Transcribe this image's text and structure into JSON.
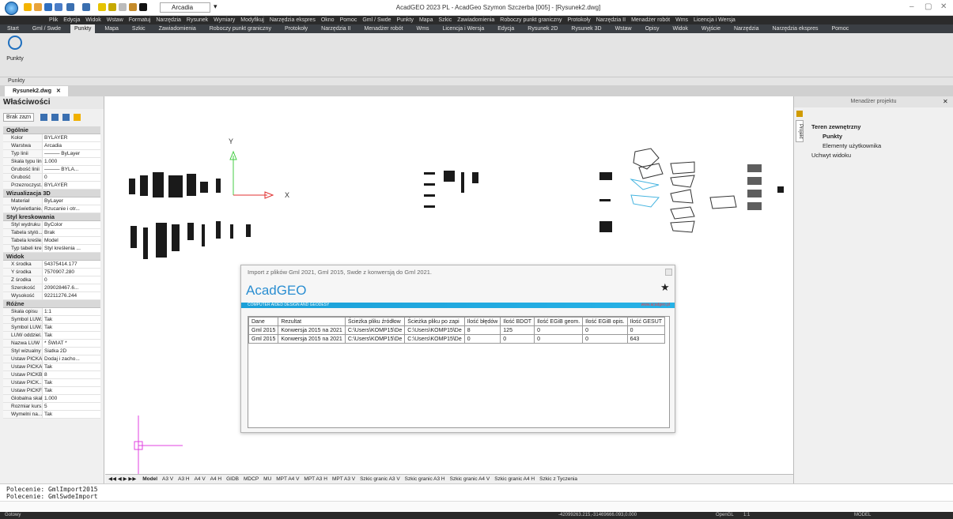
{
  "titlebar": {
    "title": "AcadGEO 2023 PL - AcadGeo Szymon Szczerba [005] - [Rysunek2.dwg]",
    "layer": "Arcadia",
    "minimize": "–",
    "maximize": "▢",
    "close": "✕"
  },
  "menu": [
    "Plik",
    "Edycja",
    "Widok",
    "Wstaw",
    "Formatuj",
    "Narzędzia",
    "Rysunek",
    "Wymiary",
    "Modyfikuj",
    "Narzędzia ekspres",
    "Okno",
    "Pomoc",
    "Gml / Swde",
    "Punkty",
    "Mapa",
    "Szkic",
    "Zawiadomienia",
    "Roboczy punkt graniczny",
    "Protokoły",
    "Narzędzia II",
    "Menadżer robót",
    "Wms",
    "Licencja i Wersja"
  ],
  "ribbon_tabs": [
    "Start",
    "Gml / Swde",
    "Punkty",
    "Mapa",
    "Szkic",
    "Zawiadomienia",
    "Roboczy punkt graniczny",
    "Protokoły",
    "Narzędzia II",
    "Menadżer robót",
    "Wms",
    "Licencja i Wersja",
    "Edycja",
    "Rysunek 2D",
    "Rysunek 3D",
    "Wstaw",
    "Opisy",
    "Widok",
    "Wyjście",
    "Narzędzia",
    "Narzędzia ekspres",
    "Pomoc"
  ],
  "ribbon": {
    "button_label": "Punkty",
    "group_label": "Punkty"
  },
  "doc_tab": {
    "label": "Rysunek2.dwg",
    "close": "✕"
  },
  "properties": {
    "title": "Właściwości",
    "selection": "Brak zazn",
    "sections": [
      {
        "name": "Ogólnie",
        "rows": [
          [
            "Kolor",
            "BYLAYER"
          ],
          [
            "Warstwa",
            "Arcadia"
          ],
          [
            "Typ linii",
            "——— ByLayer"
          ],
          [
            "Skala typu linii",
            "1.000"
          ],
          [
            "Grubość linii",
            "——— BYLA..."
          ],
          [
            "Grubość",
            "0"
          ],
          [
            "Przezroczyst...",
            "BYLAYER"
          ]
        ]
      },
      {
        "name": "Wizualizacja 3D",
        "rows": [
          [
            "Materiał",
            "ByLayer"
          ],
          [
            "Wyświetlanie...",
            "Rzucanie i otr..."
          ]
        ]
      },
      {
        "name": "Styl kreskowania",
        "rows": [
          [
            "Styl wydruku",
            "ByColor"
          ],
          [
            "Tabela styló...",
            "Brak"
          ],
          [
            "Tabela kreśle...",
            "Model"
          ],
          [
            "Typ tabeli kre...",
            "Styl kreślenia ..."
          ]
        ]
      },
      {
        "name": "Widok",
        "rows": [
          [
            "X środka",
            "54375414.177"
          ],
          [
            "Y środka",
            "7570907.280"
          ],
          [
            "Z środka",
            "0"
          ],
          [
            "Szerokość",
            "209028467.6..."
          ],
          [
            "Wysokość",
            "92211276.244"
          ]
        ]
      },
      {
        "name": "Różne",
        "rows": [
          [
            "Skala opisu",
            "1:1"
          ],
          [
            "Symbol LUW...",
            "Tak"
          ],
          [
            "Symbol LUW...",
            "Tak"
          ],
          [
            "LUW oddziel...",
            "Tak"
          ],
          [
            "Nazwa LUW",
            "* ŚWIAT *"
          ],
          [
            "Styl wizualny",
            "Siatka 2D"
          ],
          [
            "Ustaw PICKA...",
            "Dodaj i zacho..."
          ],
          [
            "Ustaw PICKA...",
            "Tak"
          ],
          [
            "Ustaw PICKB...",
            "8"
          ],
          [
            "Ustaw PICK...",
            "Tak"
          ],
          [
            "Ustaw PICKF...",
            "Tak"
          ],
          [
            "Globalna skal...",
            "1.000"
          ],
          [
            "Rozmiar kurs...",
            "5"
          ],
          [
            "Wymelni na...",
            "Tak"
          ]
        ]
      }
    ]
  },
  "ucs": {
    "x": "X",
    "y": "Y"
  },
  "layout_tabs": [
    "Model",
    "A3 V",
    "A3 H",
    "A4 V",
    "A4 H",
    "GIDB",
    "MDCP",
    "MU",
    "MPT A4 V",
    "MPT A3 H",
    "MPT A3 V",
    "Szkic granic A3 V",
    "Szkic granic A3 H",
    "Szkic granic A4 V",
    "Szkic granic A4 H",
    "Szkic z Tyczenia"
  ],
  "command_history": [
    "Polecenie: GmlImport2015",
    "Polecenie: GmlSwdeImport"
  ],
  "status": {
    "left": "Gotowy",
    "coords": "-42099263.215,-31469666.093,0.000",
    "opengl": "OpenGL",
    "scale": "1:1",
    "model": "MODEL"
  },
  "project_manager": {
    "title": "Menadżer projektu",
    "tab": "Projekt",
    "items": [
      {
        "label": "Teren zewnętrzny",
        "level": 0,
        "bold": true
      },
      {
        "label": "Punkty",
        "level": 1,
        "bold": true
      },
      {
        "label": "Elementy użytkownika",
        "level": 1,
        "bold": false
      },
      {
        "label": "Uchwyt widoku",
        "level": 0,
        "bold": false
      }
    ]
  },
  "dialog": {
    "title": "Import z plików Gml 2021, Gml 2015, Swde z konwersją do Gml 2021.",
    "logo": "AcadGEO",
    "band_left": "COMPUTER AIDED DESIGN AND GEODESY",
    "band_right": "www.acadgeo.pl",
    "columns": [
      "Dane",
      "Rezultat",
      "Ścieżka pliku źródłow",
      "Ścieżka pliku po zapi",
      "Ilość błędów",
      "Ilość BDOT",
      "Ilość EGiB geom.",
      "Ilość EGiB opis.",
      "Ilość GESUT"
    ],
    "rows": [
      [
        "Gml 2015",
        "Konwersja 2015 na 2021",
        "C:\\Users\\KOMP15\\De",
        "C:\\Users\\KOMP15\\De",
        "8",
        "125",
        "0",
        "0",
        "0"
      ],
      [
        "Gml 2015",
        "Konwersja 2015 na 2021",
        "C:\\Users\\KOMP15\\De",
        "C:\\Users\\KOMP15\\De",
        "0",
        "0",
        "0",
        "0",
        "643"
      ]
    ]
  }
}
